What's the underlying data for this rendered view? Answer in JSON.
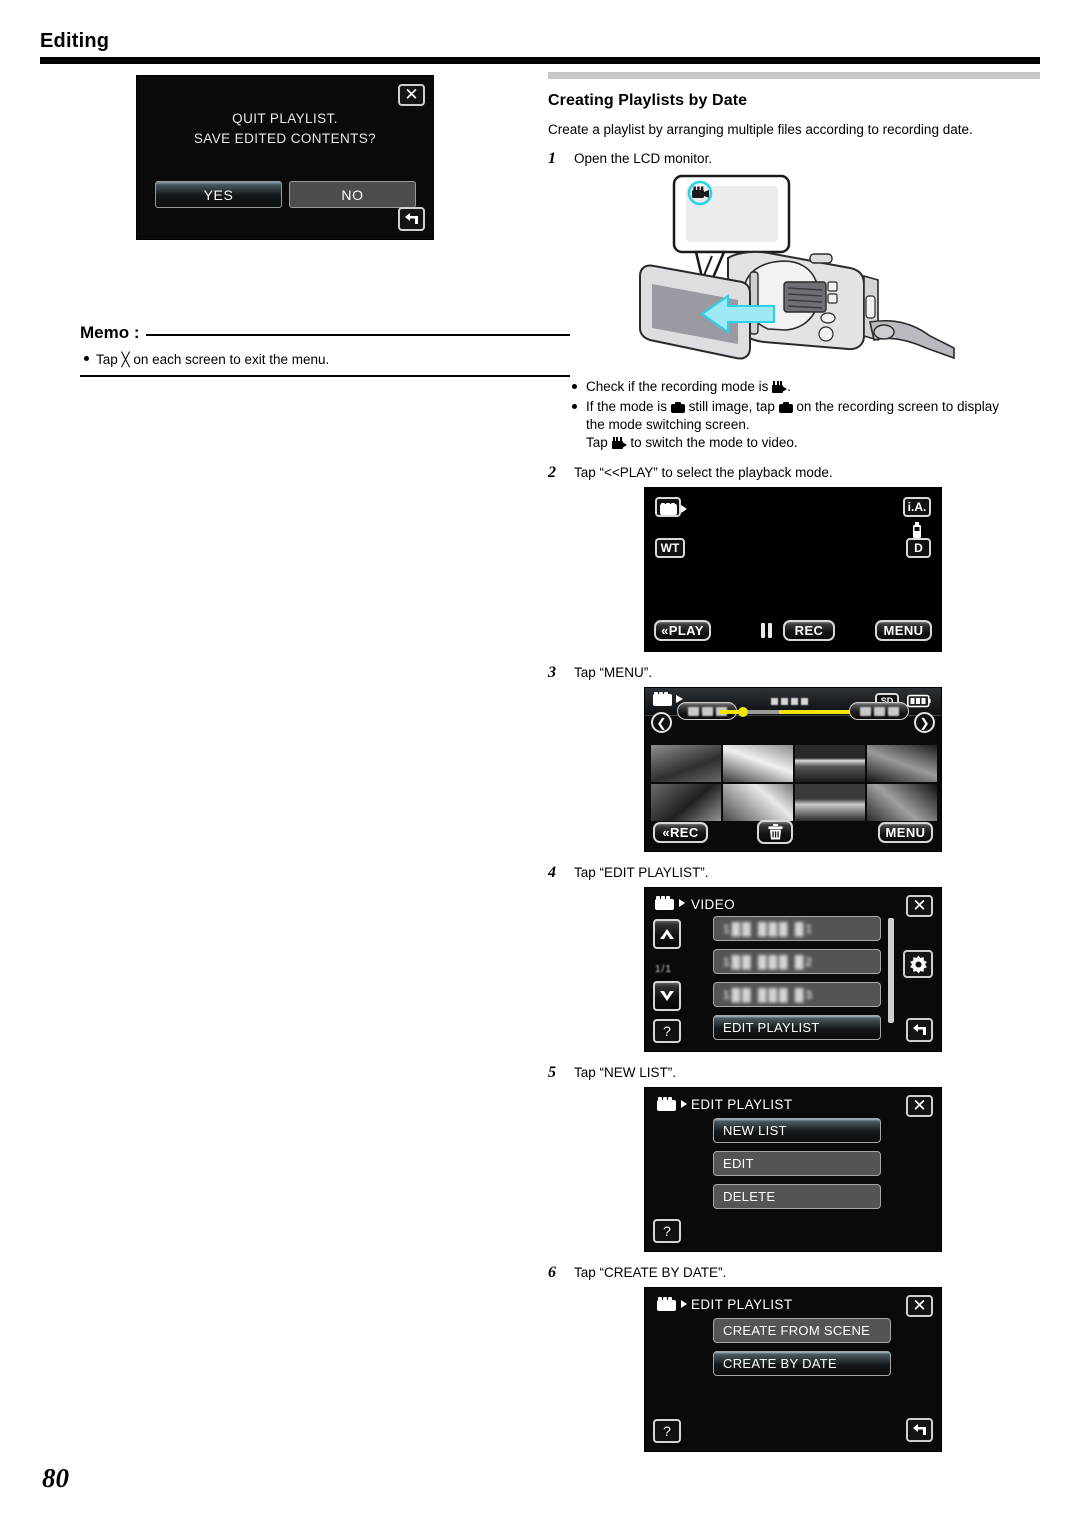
{
  "page": {
    "header_title": "Editing",
    "page_number": "80"
  },
  "dialog": {
    "message_line1": "QUIT PLAYLIST.",
    "message_line2": "SAVE EDITED CONTENTS?",
    "yes_label": "YES",
    "no_label": "NO",
    "close_icon": "close-icon",
    "back_icon": "back-arrow-icon"
  },
  "memo": {
    "title": "Memo :",
    "item": "Tap ╳ on each screen to exit the menu."
  },
  "section": {
    "title": "Creating Playlists by Date",
    "description": "Create a playlist by arranging multiple files according to recording date."
  },
  "steps": [
    {
      "num": "1",
      "text": "Open the LCD monitor."
    },
    {
      "num": "2",
      "text": "Tap “<<PLAY” to select the playback mode."
    },
    {
      "num": "3",
      "text": "Tap “MENU”."
    },
    {
      "num": "4",
      "text": "Tap “EDIT PLAYLIST”."
    },
    {
      "num": "5",
      "text": "Tap “NEW LIST”."
    },
    {
      "num": "6",
      "text": "Tap “CREATE BY DATE”."
    }
  ],
  "notes": {
    "note1_a": "Check if the recording mode is",
    "note1_b": ".",
    "note2_a": "If the mode is",
    "note2_b": "still image, tap",
    "note2_c": "on the recording screen to display",
    "note2_d": "the mode switching screen.",
    "note2_e": "Tap",
    "note2_f": "to switch the mode to video."
  },
  "rec_screen": {
    "mode_icon": "video-mode-icon",
    "ia_label": "i.A.",
    "battery_icon": "battery-icon",
    "wt_label": "WT",
    "d_label": "D",
    "play_label": "«PLAY",
    "rec_label": "REC",
    "pause_icon": "pause-icon",
    "menu_label": "MENU"
  },
  "index_screen": {
    "mode_icon": "video-mode-icon",
    "sd_label": "SD",
    "battery_icon": "battery-icon",
    "prev_icon": "chevron-left-icon",
    "next_icon": "chevron-right-icon",
    "rec_label": "«REC",
    "delete_icon": "trash-icon",
    "menu_label": "MENU",
    "thumbnail_count": 8
  },
  "video_menu": {
    "title": "VIDEO",
    "rows": [
      "",
      "",
      "",
      "EDIT PLAYLIST"
    ],
    "selected_index": 3,
    "up_icon": "chevron-up-icon",
    "down_icon": "chevron-down-icon",
    "page_indicator": "1/1",
    "help_label": "?",
    "gear_icon": "gear-icon",
    "close_icon": "close-icon",
    "back_icon": "back-arrow-icon"
  },
  "edit_playlist_menu": {
    "title": "EDIT PLAYLIST",
    "rows": [
      "NEW LIST",
      "EDIT",
      "DELETE"
    ],
    "selected_index": 0,
    "help_label": "?",
    "close_icon": "close-icon"
  },
  "create_menu": {
    "title": "EDIT PLAYLIST",
    "rows": [
      "CREATE FROM SCENE",
      "CREATE BY DATE"
    ],
    "selected_index": 1,
    "help_label": "?",
    "close_icon": "close-icon",
    "back_icon": "back-arrow-icon"
  },
  "colors": {
    "accent_cyan": "#2ad2e8",
    "timeline_yellow": "#f2e600",
    "rule_black": "#000000",
    "rule_gray": "#c8c8c8"
  }
}
